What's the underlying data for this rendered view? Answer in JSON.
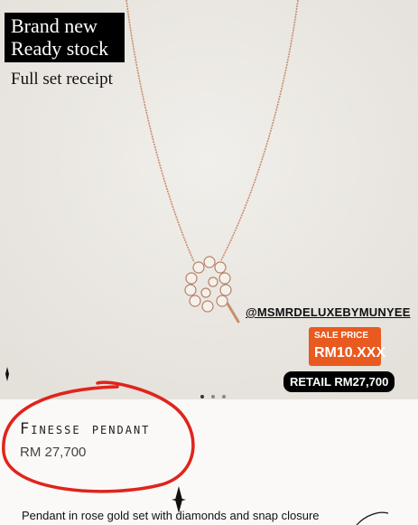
{
  "badge": {
    "line1": "Brand new",
    "line2": "Ready stock"
  },
  "receipt_note": "Full set receipt",
  "handle": "@MSMRDELUXEBYMUNYEE",
  "sale": {
    "label": "SALE PRICE",
    "price": "RM10.XXX"
  },
  "retail": "RETAIL RM27,700",
  "carousel": {
    "dots": 3,
    "active": 0
  },
  "product": {
    "name": "Finesse pendant",
    "price": "RM 27,700",
    "description": "Pendant in rose gold set with diamonds and snap closure"
  },
  "colors": {
    "accent_sale": "#e85a1f",
    "annotation": "#e0241b"
  }
}
